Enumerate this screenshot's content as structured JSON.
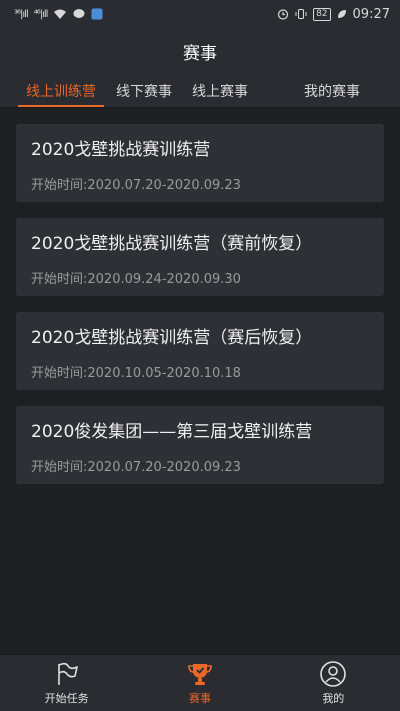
{
  "status_bar": {
    "signal1": "³⁶|ıll",
    "signal2": "⁴⁶|ıll",
    "battery": "82",
    "time": "09:27"
  },
  "header": {
    "title": "赛事"
  },
  "tabs": [
    {
      "label": "线上训练营"
    },
    {
      "label": "线下赛事"
    },
    {
      "label": "线上赛事"
    },
    {
      "label": "我的赛事"
    }
  ],
  "events": [
    {
      "title": "2020戈壁挑战赛训练营",
      "time": "开始时间:2020.07.20-2020.09.23"
    },
    {
      "title": "2020戈壁挑战赛训练营（赛前恢复）",
      "time": "开始时间:2020.09.24-2020.09.30"
    },
    {
      "title": "2020戈壁挑战赛训练营（赛后恢复）",
      "time": "开始时间:2020.10.05-2020.10.18"
    },
    {
      "title": "2020俊发集团——第三届戈壁训练营",
      "time": "开始时间:2020.07.20-2020.09.23"
    }
  ],
  "bottom_nav": [
    {
      "label": "开始任务",
      "icon": "flag-icon"
    },
    {
      "label": "赛事",
      "icon": "trophy-icon"
    },
    {
      "label": "我的",
      "icon": "user-icon"
    }
  ],
  "colors": {
    "accent": "#e8682a",
    "background": "#1e1f23",
    "card": "#2f3035",
    "bar": "#2b2c31"
  }
}
